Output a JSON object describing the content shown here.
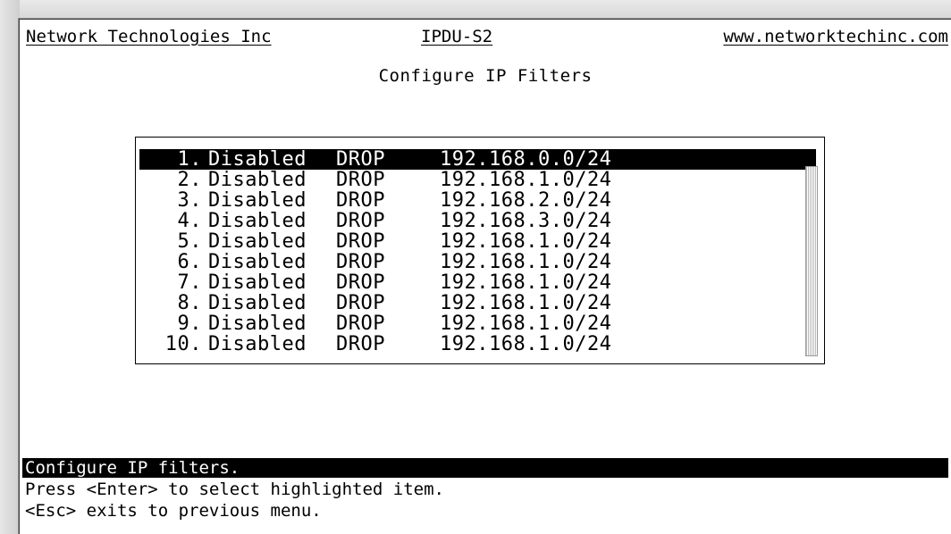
{
  "header": {
    "company": "Network Technologies Inc",
    "device": "IPDU-S2",
    "website": "www.networktechinc.com"
  },
  "title": "Configure IP Filters",
  "filters": [
    {
      "num": "1.",
      "state": "Disabled",
      "action": "DROP",
      "ip": "192.168.0.0/24",
      "selected": true
    },
    {
      "num": "2.",
      "state": "Disabled",
      "action": "DROP",
      "ip": "192.168.1.0/24"
    },
    {
      "num": "3.",
      "state": "Disabled",
      "action": "DROP",
      "ip": "192.168.2.0/24"
    },
    {
      "num": "4.",
      "state": "Disabled",
      "action": "DROP",
      "ip": "192.168.3.0/24"
    },
    {
      "num": "5.",
      "state": "Disabled",
      "action": "DROP",
      "ip": "192.168.1.0/24"
    },
    {
      "num": "6.",
      "state": "Disabled",
      "action": "DROP",
      "ip": "192.168.1.0/24"
    },
    {
      "num": "7.",
      "state": "Disabled",
      "action": "DROP",
      "ip": "192.168.1.0/24"
    },
    {
      "num": "8.",
      "state": "Disabled",
      "action": "DROP",
      "ip": "192.168.1.0/24"
    },
    {
      "num": "9.",
      "state": "Disabled",
      "action": "DROP",
      "ip": "192.168.1.0/24"
    },
    {
      "num": "10.",
      "state": "Disabled",
      "action": "DROP",
      "ip": "192.168.1.0/24"
    }
  ],
  "status": "Configure IP filters.",
  "help": [
    "Press <Enter> to select highlighted item.",
    "<Esc> exits to previous menu."
  ]
}
